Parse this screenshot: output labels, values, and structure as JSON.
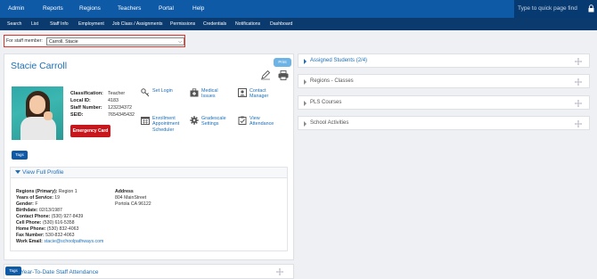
{
  "topnav": {
    "items": [
      "Admin",
      "Reports",
      "Regions",
      "Teachers",
      "Portal",
      "Help"
    ],
    "quickfind_placeholder": "Type to quick page find"
  },
  "subnav": {
    "items": [
      "Search",
      "List",
      "Staff Info",
      "Employment",
      "Job Class / Assignments",
      "Permissions",
      "Credentials",
      "Notifications",
      "Dashboard"
    ]
  },
  "staff_select": {
    "label": "For staff member:",
    "value": "Carroll, Stacie"
  },
  "profile": {
    "name": "Stacie Carroll",
    "print_label": "Print",
    "fields": [
      {
        "label": "Classification:",
        "value": "Teacher"
      },
      {
        "label": "Local ID:",
        "value": "4183"
      },
      {
        "label": "Staff Number:",
        "value": "123234372"
      },
      {
        "label": "SEID:",
        "value": "7654345432"
      }
    ],
    "emergency_label": "Emergency Card",
    "tags_label": "Tags",
    "actions": [
      {
        "label": "Set Login",
        "icon": "key-icon"
      },
      {
        "label": "Medical Issues",
        "icon": "medical-kit-icon"
      },
      {
        "label": "Contact Manager",
        "icon": "contact-card-icon"
      },
      {
        "label": "Enrollment Appointment Scheduler",
        "icon": "calendar-icon"
      },
      {
        "label": "Gradescale Settings",
        "icon": "gear-icon"
      },
      {
        "label": "View Attendance",
        "icon": "checklist-icon"
      }
    ]
  },
  "full_profile": {
    "title": "View Full Profile",
    "left": [
      {
        "label": "Regions (Primary):",
        "value": "Region 1"
      },
      {
        "label": "Years of Service:",
        "value": "19"
      },
      {
        "label": "Gender:",
        "value": "F"
      },
      {
        "label": "Birthdate:",
        "value": "02/13/1987"
      },
      {
        "label": "Contact Phone:",
        "value": "(530) 927-8439"
      },
      {
        "label": "Cell Phone:",
        "value": "(530) 616-5358"
      },
      {
        "label": "Home Phone:",
        "value": "(530) 832-4063"
      },
      {
        "label": "Fax Number:",
        "value": "530-832-4063"
      },
      {
        "label": "Work Email:",
        "value": "stacie@schoolpathways.com"
      }
    ],
    "address_label": "Address",
    "address_lines": [
      "804 MainStreet",
      "Portola CA 96122"
    ]
  },
  "bottom_card": {
    "title": "Year-To-Date Staff Attendance",
    "tags_label": "Tags"
  },
  "panels": [
    {
      "title": "Assigned Students (2/4)",
      "active": true
    },
    {
      "title": "Regions - Classes",
      "active": false
    },
    {
      "title": "PLS Courses",
      "active": false
    },
    {
      "title": "School Activities",
      "active": false
    }
  ]
}
